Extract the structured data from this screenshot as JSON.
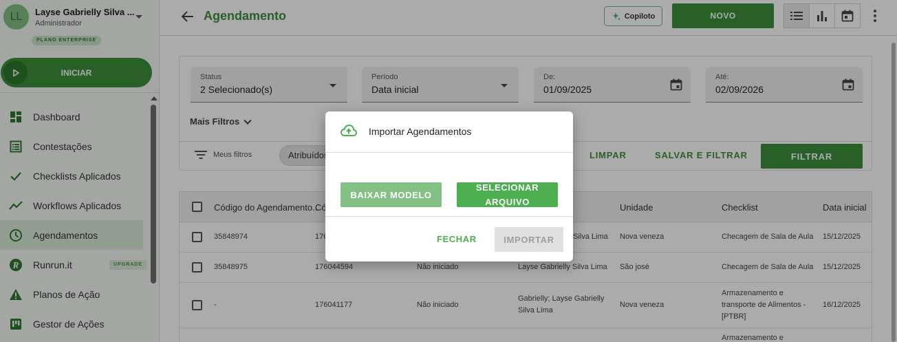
{
  "user": {
    "initials": "LL",
    "name": "Layse Gabrielly Silva ...",
    "role": "Administrador",
    "plan": "PLANO ENTERPRISE"
  },
  "sidebar": {
    "start_label": "INICIAR",
    "items": [
      {
        "label": "Dashboard",
        "icon": "dashboard-icon"
      },
      {
        "label": "Contestações",
        "icon": "list-icon"
      },
      {
        "label": "Checklists Aplicados",
        "icon": "check-icon"
      },
      {
        "label": "Workflows Aplicados",
        "icon": "trend-icon"
      },
      {
        "label": "Agendamentos",
        "icon": "clock-icon",
        "active": true
      },
      {
        "label": "Runrun.it",
        "icon": "runrun-icon",
        "tag": "UPGRADE"
      },
      {
        "label": "Planos de Ação",
        "icon": "warning-icon"
      },
      {
        "label": "Gestor de Ações",
        "icon": "board-icon"
      }
    ]
  },
  "header": {
    "title": "Agendamento",
    "copilot_label": "Copiloto",
    "new_label": "NOVO"
  },
  "filters": {
    "status": {
      "label": "Status",
      "value": "2 Selecionado(s)"
    },
    "period": {
      "label": "Período",
      "value": "Data inicial"
    },
    "from": {
      "label": "De:",
      "value": "01/09/2025"
    },
    "to": {
      "label": "Até:",
      "value": "02/09/2026"
    },
    "more_label": "Mais Filtros",
    "my_filters_label": "Meus filtros",
    "chip_label": "Atribuídos",
    "clear_label": "LIMPAR",
    "save_filter_label": "SALVAR E FILTRAR",
    "filter_label": "FILTRAR"
  },
  "table": {
    "columns": [
      "Código do Agendamento...",
      "Có",
      "Unidade",
      "Checklist",
      "Data inicial"
    ],
    "rows": [
      {
        "code": "35848974",
        "code2": "176",
        "status": "",
        "people": "Silva Lima",
        "unit": "Nova veneza",
        "checklist": "Checagem de Sala de Aula",
        "date": "15/12/2025"
      },
      {
        "code": "35848975",
        "code2": "176044594",
        "status": "Não iniciado",
        "people": "Layse Gabrielly Silva Lima",
        "unit": "São josé",
        "checklist": "Checagem de Sala de Aula",
        "date": "15/12/2025"
      },
      {
        "code": "-",
        "code2": "176041177",
        "status": "Não iniciado",
        "people": "Gabrielly; Layse Gabrielly Silva Lima",
        "unit": "Nova veneza",
        "checklist": "Armazenamento e transporte de Alimentos - [PTBR]",
        "date": "16/12/2025"
      },
      {
        "code": "",
        "code2": "",
        "status": "",
        "people": "",
        "unit": "",
        "checklist": "Armazenamento e",
        "date": ""
      }
    ]
  },
  "modal": {
    "title": "Importar Agendamentos",
    "download_model_label": "BAIXAR MODELO",
    "select_file_label": "SELECIONAR ARQUIVO",
    "close_label": "FECHAR",
    "import_label": "IMPORTAR"
  },
  "colors": {
    "brand_green": "#3d8f3d",
    "accent_green": "#4caf50",
    "overlay": "rgba(0,0,0,0.33)"
  }
}
